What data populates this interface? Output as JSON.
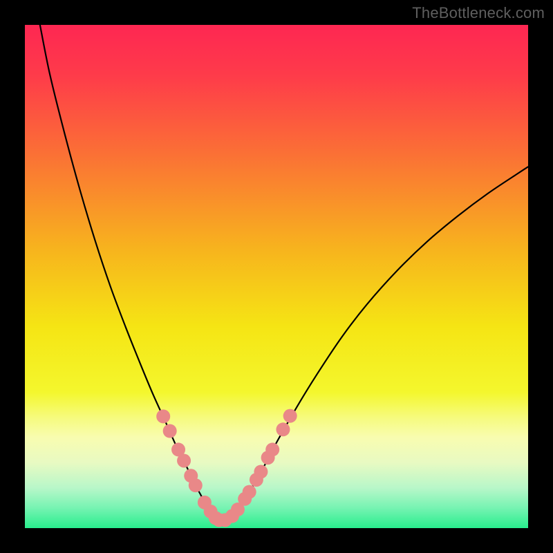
{
  "watermark": "TheBottleneck.com",
  "colors": {
    "black": "#000000",
    "curve_stroke": "#000000",
    "dot_fill": "#e98888",
    "dot_stroke": "#c96a6a"
  },
  "gradient_stops": [
    {
      "offset": 0.0,
      "color": "#fe2752"
    },
    {
      "offset": 0.1,
      "color": "#fe3b4a"
    },
    {
      "offset": 0.25,
      "color": "#fb6e36"
    },
    {
      "offset": 0.45,
      "color": "#f7b51d"
    },
    {
      "offset": 0.6,
      "color": "#f5e514"
    },
    {
      "offset": 0.73,
      "color": "#f4f72d"
    },
    {
      "offset": 0.78,
      "color": "#f6fb7d"
    },
    {
      "offset": 0.82,
      "color": "#f8fcb0"
    },
    {
      "offset": 0.87,
      "color": "#e8fac2"
    },
    {
      "offset": 0.92,
      "color": "#b8f7c9"
    },
    {
      "offset": 0.96,
      "color": "#76f3b2"
    },
    {
      "offset": 1.0,
      "color": "#28ee8d"
    }
  ],
  "chart_data": {
    "type": "line",
    "title": "",
    "xlabel": "",
    "ylabel": "",
    "xlim": [
      0,
      100
    ],
    "ylim": [
      0,
      100
    ],
    "series": [
      {
        "name": "curve",
        "x": [
          3,
          5,
          8,
          11,
          14,
          17,
          20,
          23,
          25.5,
          28,
          30,
          32,
          33.5,
          35,
          36.2,
          37.2,
          38,
          40,
          42,
          44,
          47,
          50,
          54,
          58,
          63,
          68,
          74,
          80,
          86,
          92,
          98,
          100
        ],
        "y": [
          100,
          90,
          78,
          67,
          57,
          48,
          40,
          32.5,
          26.5,
          21,
          16.5,
          12.5,
          9.3,
          6.5,
          4.3,
          2.7,
          1.6,
          1.6,
          3.3,
          6.2,
          11.3,
          17,
          24,
          30.5,
          38,
          44.5,
          51.2,
          57,
          62,
          66.5,
          70.5,
          71.8
        ]
      }
    ],
    "dots": [
      {
        "x": 27.5,
        "y": 22.2
      },
      {
        "x": 28.8,
        "y": 19.3
      },
      {
        "x": 30.5,
        "y": 15.6
      },
      {
        "x": 31.6,
        "y": 13.4
      },
      {
        "x": 33.0,
        "y": 10.4
      },
      {
        "x": 33.9,
        "y": 8.5
      },
      {
        "x": 35.7,
        "y": 5.1
      },
      {
        "x": 36.9,
        "y": 3.3
      },
      {
        "x": 37.9,
        "y": 2.0
      },
      {
        "x": 38.6,
        "y": 1.6
      },
      {
        "x": 39.8,
        "y": 1.6
      },
      {
        "x": 41.2,
        "y": 2.4
      },
      {
        "x": 42.3,
        "y": 3.7
      },
      {
        "x": 43.7,
        "y": 5.8
      },
      {
        "x": 44.6,
        "y": 7.2
      },
      {
        "x": 46.0,
        "y": 9.6
      },
      {
        "x": 46.9,
        "y": 11.2
      },
      {
        "x": 48.3,
        "y": 14.0
      },
      {
        "x": 49.2,
        "y": 15.6
      },
      {
        "x": 51.3,
        "y": 19.6
      },
      {
        "x": 52.7,
        "y": 22.3
      }
    ],
    "dot_radius": 10
  }
}
